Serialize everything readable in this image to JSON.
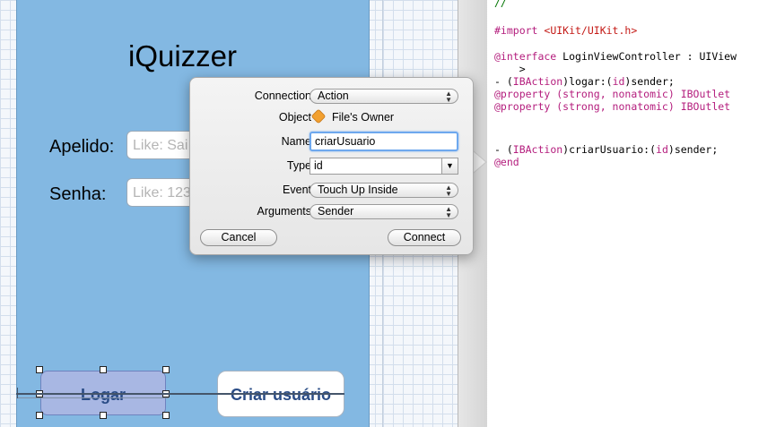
{
  "storyboard": {
    "app_title": "iQuizzer",
    "apelido_label": "Apelido:",
    "apelido_placeholder": "Like: Sai",
    "senha_label": "Senha:",
    "senha_placeholder": "Like: 123",
    "logar_button": "Logar",
    "criar_button": "Criar usuário"
  },
  "popover": {
    "rows": {
      "connection_label": "Connection",
      "connection_value": "Action",
      "object_label": "Object",
      "object_value": "File's Owner",
      "name_label": "Name",
      "name_value": "criarUsuario",
      "type_label": "Type",
      "type_value": "id",
      "event_label": "Event",
      "event_value": "Touch Up Inside",
      "arguments_label": "Arguments",
      "arguments_value": "Sender"
    },
    "cancel_button": "Cancel",
    "connect_button": "Connect"
  },
  "editor": {
    "lines": {
      "comment": "//",
      "import_kw": "#import ",
      "import_str": "<UIKit/UIKit.h>",
      "interface_kw": "@interface",
      "interface_rest": " LoginViewController : UIView",
      "interface_cont": "    >",
      "logar_a": "- (",
      "logar_kw": "IBAction",
      "logar_b": ")logar:(",
      "logar_id": "id",
      "logar_c": ")sender;",
      "prop1": "@property (strong, nonatomic) IBOutlet",
      "prop2": "@property (strong, nonatomic) IBOutlet",
      "criar_a": "- (",
      "criar_kw": "IBAction",
      "criar_b": ")criarUsuario:(",
      "criar_id": "id",
      "criar_c": ")sender;",
      "end_kw": "@end"
    }
  },
  "colors": {
    "view_background": "#83b8e2",
    "keyword": "#b41d7d",
    "string": "#c41a16",
    "focus_ring": "#6ea8ee"
  }
}
